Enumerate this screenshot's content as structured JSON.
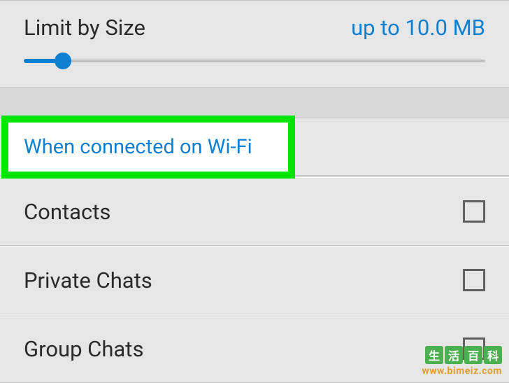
{
  "size_section": {
    "title": "Limit by Size",
    "value": "up to 10.0 MB",
    "slider_percent": 8
  },
  "highlighted_header": "When connected on Wi-Fi",
  "rows": [
    {
      "label": "Contacts",
      "checked": false
    },
    {
      "label": "Private Chats",
      "checked": false
    },
    {
      "label": "Group Chats",
      "checked": false
    }
  ],
  "watermark": {
    "chars": [
      "生",
      "活",
      "百",
      "科"
    ],
    "url": "www.bimeiz.com"
  }
}
